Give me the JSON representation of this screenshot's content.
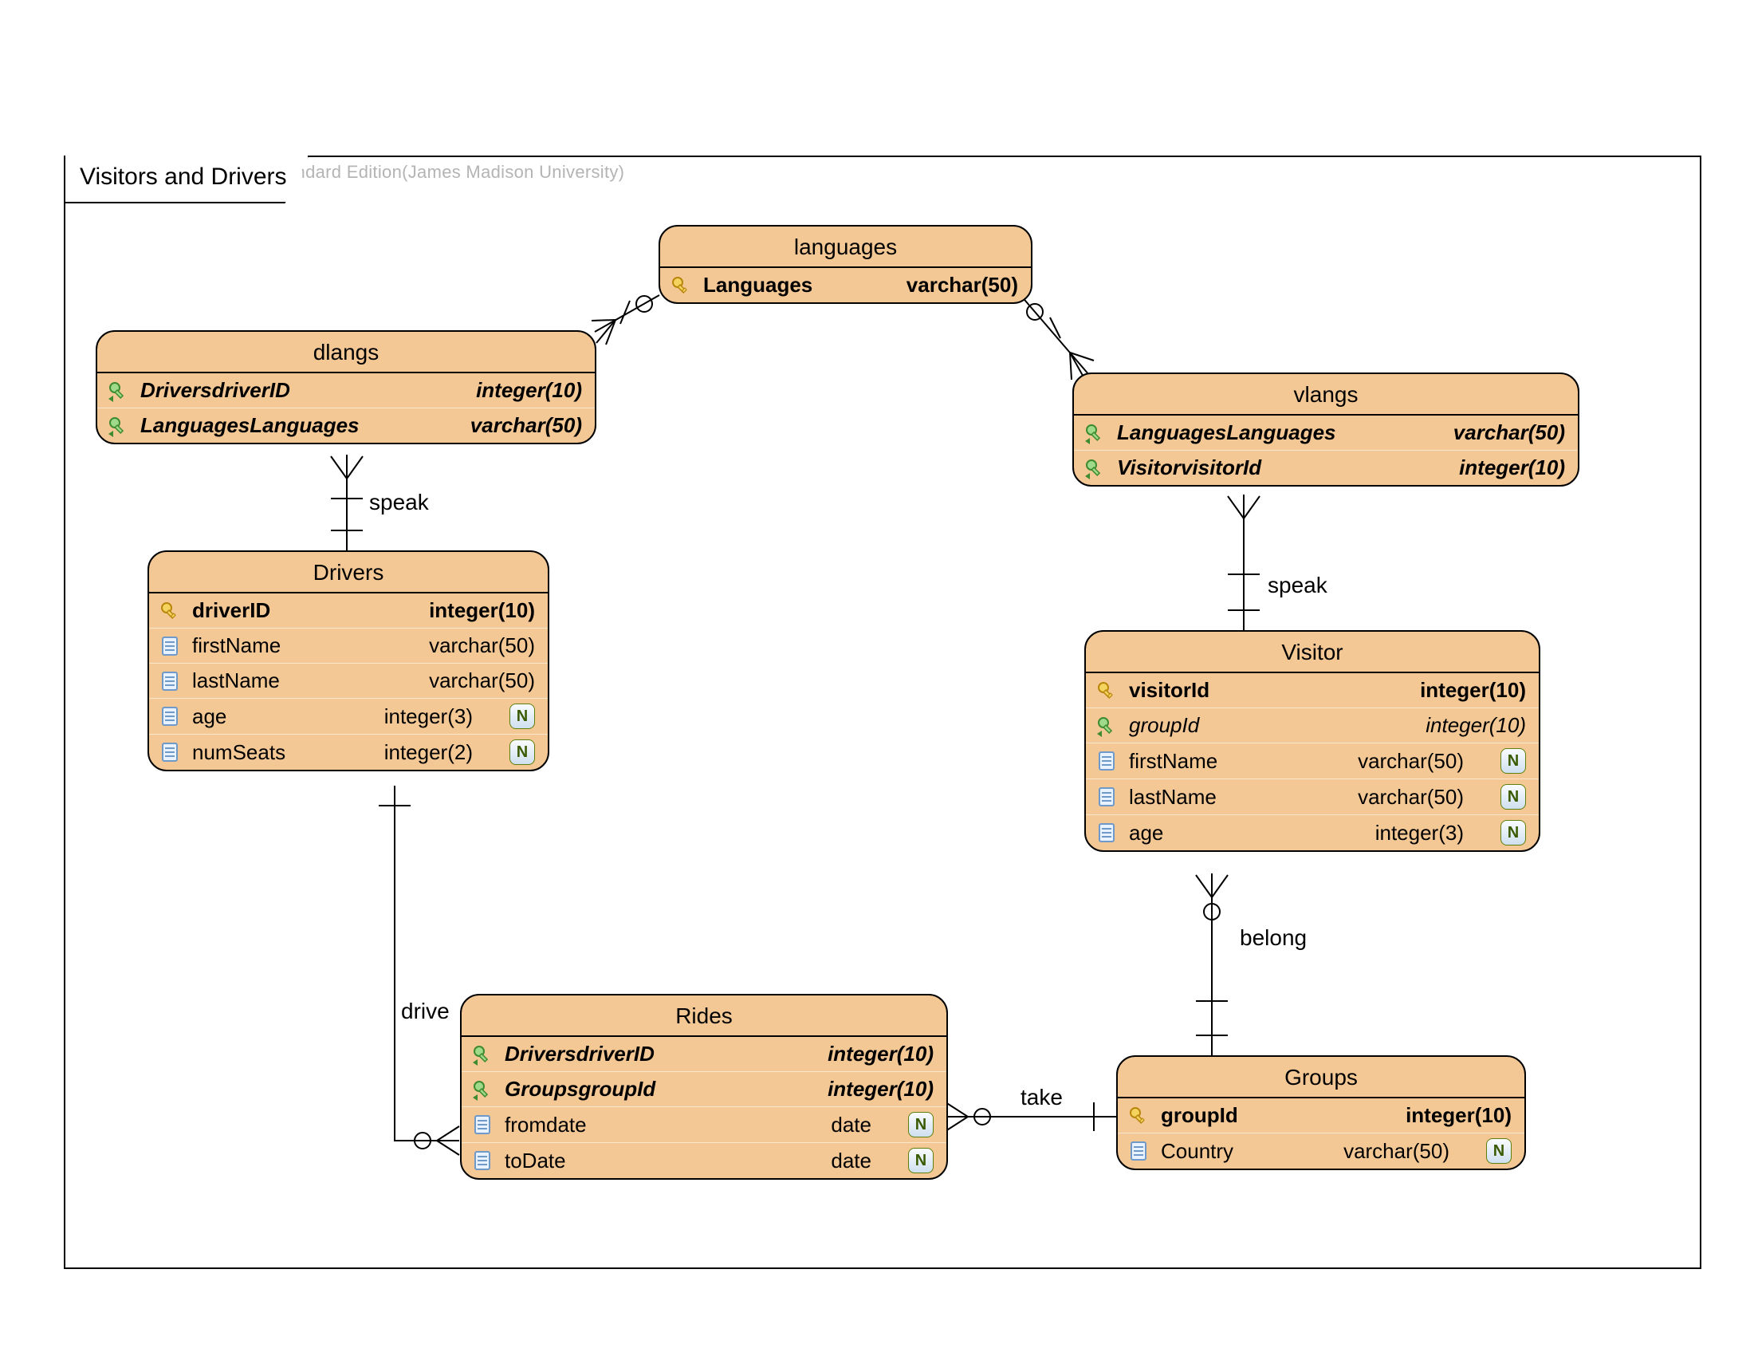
{
  "meta": {
    "tool_watermark": "Visual Paradigm for UML Standard Edition(James Madison University)",
    "diagram_title": "Visitors and Drivers"
  },
  "entities": {
    "languages": {
      "title": "languages",
      "rows": [
        {
          "icon": "pk",
          "name": "Languages",
          "type": "varchar(50)",
          "bold": true,
          "italic": false,
          "nullable": false
        }
      ]
    },
    "dlangs": {
      "title": "dlangs",
      "rows": [
        {
          "icon": "fk",
          "name": "DriversdriverID",
          "type": "integer(10)",
          "bold": true,
          "italic": true,
          "nullable": false
        },
        {
          "icon": "fk",
          "name": "LanguagesLanguages",
          "type": "varchar(50)",
          "bold": true,
          "italic": true,
          "nullable": false
        }
      ]
    },
    "vlangs": {
      "title": "vlangs",
      "rows": [
        {
          "icon": "fk",
          "name": "LanguagesLanguages",
          "type": "varchar(50)",
          "bold": true,
          "italic": true,
          "nullable": false
        },
        {
          "icon": "fk",
          "name": "VisitorvisitorId",
          "type": "integer(10)",
          "bold": true,
          "italic": true,
          "nullable": false
        }
      ]
    },
    "drivers": {
      "title": "Drivers",
      "rows": [
        {
          "icon": "pk",
          "name": "driverID",
          "type": "integer(10)",
          "bold": true,
          "italic": false,
          "nullable": false
        },
        {
          "icon": "col",
          "name": "firstName",
          "type": "varchar(50)",
          "bold": false,
          "italic": false,
          "nullable": false
        },
        {
          "icon": "col",
          "name": "lastName",
          "type": "varchar(50)",
          "bold": false,
          "italic": false,
          "nullable": false
        },
        {
          "icon": "col",
          "name": "age",
          "type": "integer(3)",
          "bold": false,
          "italic": false,
          "nullable": true
        },
        {
          "icon": "col",
          "name": "numSeats",
          "type": "integer(2)",
          "bold": false,
          "italic": false,
          "nullable": true
        }
      ]
    },
    "visitor": {
      "title": "Visitor",
      "rows": [
        {
          "icon": "pk",
          "name": "visitorId",
          "type": "integer(10)",
          "bold": true,
          "italic": false,
          "nullable": false
        },
        {
          "icon": "fk",
          "name": "groupId",
          "type": "integer(10)",
          "bold": false,
          "italic": true,
          "nullable": false
        },
        {
          "icon": "col",
          "name": "firstName",
          "type": "varchar(50)",
          "bold": false,
          "italic": false,
          "nullable": true
        },
        {
          "icon": "col",
          "name": "lastName",
          "type": "varchar(50)",
          "bold": false,
          "italic": false,
          "nullable": true
        },
        {
          "icon": "col",
          "name": "age",
          "type": "integer(3)",
          "bold": false,
          "italic": false,
          "nullable": true
        }
      ]
    },
    "rides": {
      "title": "Rides",
      "rows": [
        {
          "icon": "fk",
          "name": "DriversdriverID",
          "type": "integer(10)",
          "bold": true,
          "italic": true,
          "nullable": false
        },
        {
          "icon": "fk",
          "name": "GroupsgroupId",
          "type": "integer(10)",
          "bold": true,
          "italic": true,
          "nullable": false
        },
        {
          "icon": "col",
          "name": "fromdate",
          "type": "date",
          "bold": false,
          "italic": false,
          "nullable": true
        },
        {
          "icon": "col",
          "name": "toDate",
          "type": "date",
          "bold": false,
          "italic": false,
          "nullable": true
        }
      ]
    },
    "groups": {
      "title": "Groups",
      "rows": [
        {
          "icon": "pk",
          "name": "groupId",
          "type": "integer(10)",
          "bold": true,
          "italic": false,
          "nullable": false
        },
        {
          "icon": "col",
          "name": "Country",
          "type": "varchar(50)",
          "bold": false,
          "italic": false,
          "nullable": true
        }
      ]
    }
  },
  "relationships": {
    "speak_left": "speak",
    "speak_right": "speak",
    "drive": "drive",
    "take": "take",
    "belong": "belong"
  }
}
